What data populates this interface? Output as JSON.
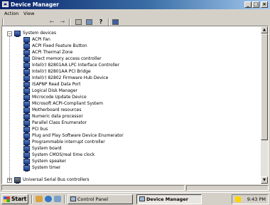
{
  "window": {
    "title": "Device Manager",
    "controls": {
      "minimize": "_",
      "maximize": "□",
      "close": "×"
    }
  },
  "menubar": {
    "items": [
      "Action",
      "View"
    ]
  },
  "toolbar": {
    "back": "←",
    "forward": "→",
    "help": "?"
  },
  "tree": {
    "parent_label": "System devices",
    "parent_expander": "−",
    "children": [
      "ACPI Fan",
      "ACPI Fixed Feature Button",
      "ACPI Thermal Zone",
      "Direct memory access controller",
      "Intel(r) 82801AA LPC Interface Controller",
      "Intel(r) 82801AA PCI Bridge",
      "Intel(r) 82802 Firmware Hub Device",
      "ISAPNP Read Data Port",
      "Logical Disk Manager",
      "Microcode Update Device",
      "Microsoft ACPI-Compliant System",
      "Motherboard resources",
      "Numeric data processor",
      "Parallel Class Enumerator",
      "PCI bus",
      "Plug and Play Software Device Enumerator",
      "Programmable interrupt controller",
      "System board",
      "System CMOS/real time clock",
      "System speaker",
      "System timer"
    ],
    "next_label": "Universal Serial Bus controllers",
    "next_expander": "+"
  },
  "scrollbar": {
    "up": "▲",
    "down": "▼"
  },
  "taskbar": {
    "start_label": "Start",
    "tasks": [
      "Control Panel",
      "Device Manager"
    ],
    "clock": "9:43 PM"
  }
}
